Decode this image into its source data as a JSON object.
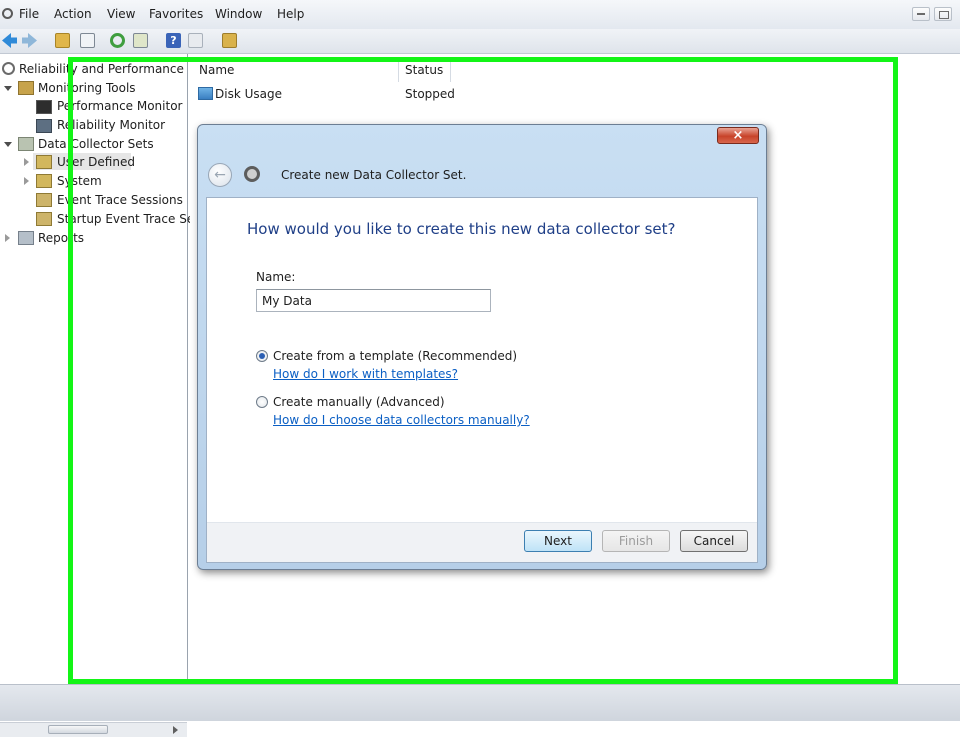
{
  "menu": {
    "items": [
      "File",
      "Action",
      "View",
      "Favorites",
      "Window",
      "Help"
    ]
  },
  "toolbar": {
    "icons": [
      "back-icon",
      "forward-icon",
      "up-folder-icon",
      "show-hide-tree-icon",
      "refresh-icon",
      "export-icon",
      "help-icon",
      "properties-icon",
      "new-icon"
    ]
  },
  "tree": {
    "root": "Reliability and Performance",
    "monitoring_tools": "Monitoring Tools",
    "performance_monitor": "Performance Monitor",
    "reliability_monitor": "Reliability Monitor",
    "data_collector_sets": "Data Collector Sets",
    "user_defined": "User Defined",
    "system": "System",
    "event_trace_sessions": "Event Trace Sessions",
    "startup_event_trace_sessions": "Startup Event Trace Ses",
    "reports": "Reports"
  },
  "list": {
    "columns": [
      "Name",
      "Status"
    ],
    "rows": [
      {
        "name": "Disk Usage",
        "status": "Stopped"
      }
    ]
  },
  "dialog": {
    "close_label": "×",
    "title": "Create new Data Collector Set.",
    "question": "How would you like to create this new data collector set?",
    "name_label": "Name:",
    "name_value": "My Data",
    "option_template": "Create from a template (Recommended)",
    "link_template": "How do I work with templates?",
    "option_manual": "Create manually (Advanced)",
    "link_manual": "How do I choose data collectors manually?",
    "selected_option": "template",
    "buttons": {
      "next": "Next",
      "finish": "Finish",
      "cancel": "Cancel"
    }
  },
  "colors": {
    "highlight": "#13f516",
    "question_text": "#1f3f87",
    "link": "#0b5fc4",
    "close_button": "#c8432a"
  }
}
